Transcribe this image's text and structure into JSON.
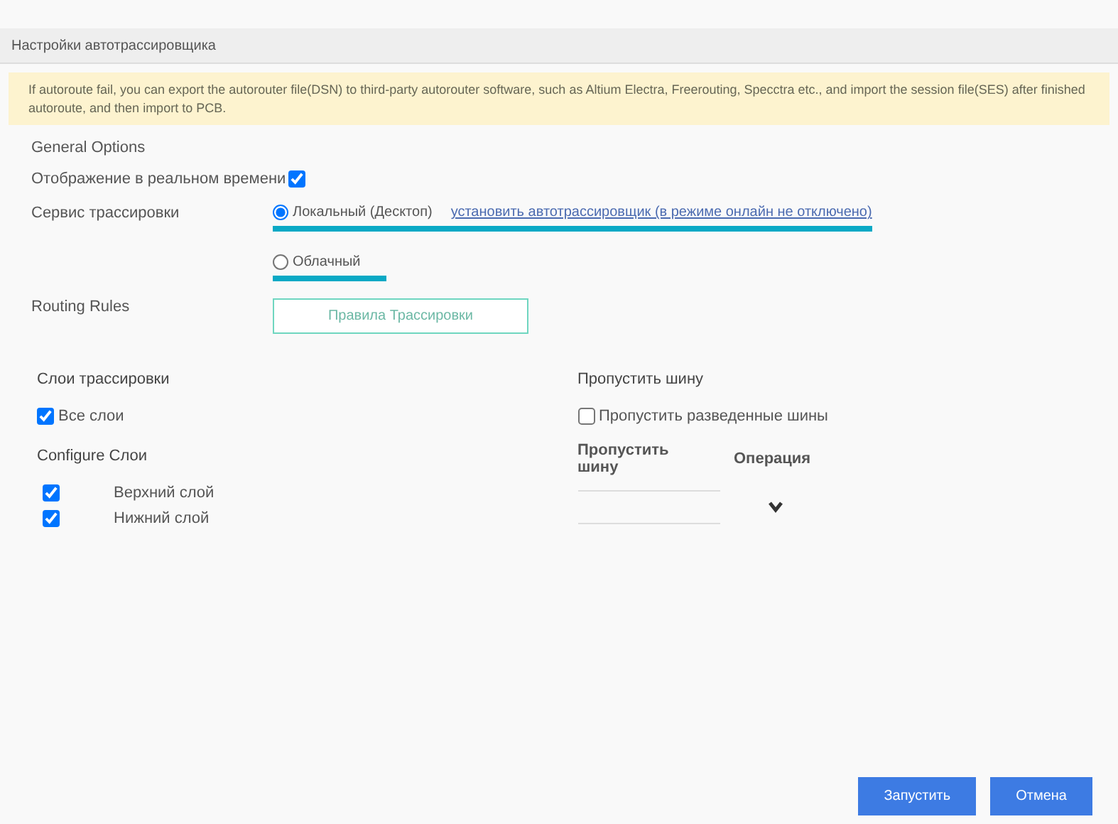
{
  "window": {
    "title": "Настройки автотрассировщика"
  },
  "notice": "If autoroute fail, you can export the autorouter file(DSN) to third-party autorouter software, such as Altium Electra, Freerouting, Specctra etc., and import the session file(SES) after finished autoroute, and then import to PCB.",
  "general": {
    "heading": "General Options",
    "realtime": {
      "label": "Отображение в реальном времени",
      "checked": true
    },
    "service": {
      "label": "Сервис трассировки",
      "options": [
        {
          "label": "Локальный (Десктоп)",
          "selected": true,
          "link": "установить автотрассировщик (в режиме онлайн не отключено)"
        },
        {
          "label": "Облачный",
          "selected": false
        }
      ]
    },
    "rules": {
      "label": "Routing Rules",
      "button": "Правила Трассировки"
    }
  },
  "layers": {
    "heading": "Слои трассировки",
    "all": {
      "label": "Все слои",
      "checked": true
    },
    "configure": "Configure Слои",
    "items": [
      {
        "label": "Верхний слой",
        "checked": true
      },
      {
        "label": "Нижний слой",
        "checked": true
      }
    ]
  },
  "skip": {
    "heading": "Пропустить шину",
    "routed": {
      "label": "Пропустить разведенные шины",
      "checked": false
    },
    "columns": [
      "Пропустить шину",
      "Операция"
    ]
  },
  "buttons": [
    "Запустить",
    "Отмена"
  ]
}
